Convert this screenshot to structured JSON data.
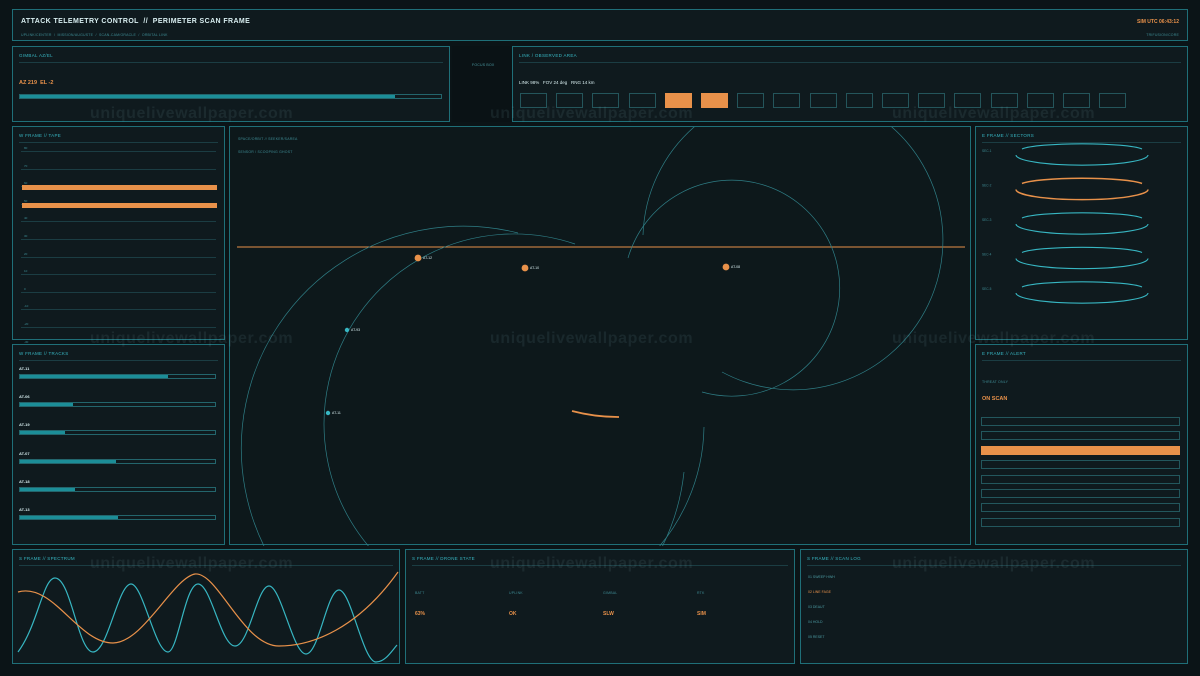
{
  "header": {
    "title": "ATTACK TELEMETRY CONTROL  //  PERIMETER SCAN FRAME",
    "breadcrumb": "UPLINK/CENTER  /  MISSION/AUGUSTE  /  SCAN-CAM/ORACLE  /  ORBITAL LINK",
    "clock": "SIM UTC 06:43:12",
    "mode": "TRIFUSION/CORE"
  },
  "gimbal": {
    "title": "GIMBAL AZ/EL",
    "readout": "AZ 219  EL -2",
    "progress": 0.89
  },
  "focus_badge": "FOCUS BOX",
  "link": {
    "title": "LINK / OBSERVED AREA",
    "stats": "LINK 98%   FOV 24 deg   RNG 14 km",
    "segments": [
      false,
      false,
      false,
      false,
      true,
      true,
      false,
      false,
      false,
      false,
      false,
      false,
      false,
      false,
      false,
      false,
      false
    ]
  },
  "tape": {
    "title": "W FRAME  //  TAPE",
    "labels": [
      "80",
      "70",
      "60",
      "50",
      "40",
      "30",
      "20",
      "10",
      "0",
      "-10",
      "-20",
      "-30"
    ]
  },
  "tracks": {
    "title": "W FRAME  //  TRACKS",
    "items": [
      {
        "id": "AT-11",
        "value": 0.76
      },
      {
        "id": "AT-06",
        "value": 0.27
      },
      {
        "id": "AT-19",
        "value": 0.23
      },
      {
        "id": "AT-07",
        "value": 0.49
      },
      {
        "id": "AT-18",
        "value": 0.28
      },
      {
        "id": "AT-13",
        "value": 0.5
      }
    ]
  },
  "center": {
    "title": "SPACE/ORBIT  //  SEEKER/SAREA",
    "subtitle": "SENSOR / SCOOPING GHOST",
    "targets": [
      {
        "id": "AT-12",
        "type": "orange"
      },
      {
        "id": "AT-10",
        "type": "orange"
      },
      {
        "id": "AT-08",
        "type": "orange"
      },
      {
        "id": "AT-93",
        "type": "teal"
      },
      {
        "id": "AT-11",
        "type": "teal"
      }
    ]
  },
  "sectors": {
    "title": "E FRAME  //  SECTORS",
    "labels": [
      "SEC-1",
      "SEC-2",
      "SEC-3",
      "SEC-4",
      "SEC-5"
    ],
    "active": 1
  },
  "alert": {
    "title": "E FRAME  //  ALERT",
    "caption": "THREAT ONLY",
    "status": "ON SCAN",
    "rows": [
      false,
      false,
      true,
      false,
      false,
      false,
      false,
      false
    ],
    "colors": {
      "accent": "#e8914a",
      "teal": "#37b6c2"
    }
  },
  "spectrum": {
    "title": "S FRAME  //  SPECTRUM"
  },
  "drone": {
    "title": "S FRAME  //  DRONE STATE",
    "cols": [
      {
        "label": "BATT",
        "value": "63%"
      },
      {
        "label": "UPLINK",
        "value": "OK"
      },
      {
        "label": "GIMBAL",
        "value": "SLW"
      },
      {
        "label": "RTK",
        "value": "SIM"
      }
    ]
  },
  "scanlog": {
    "title": "S FRAME  //  SCAN LOG",
    "items": [
      {
        "text": "01 SWEEP HWH",
        "hl": false
      },
      {
        "text": "02 LINE FAGE",
        "hl": true
      },
      {
        "text": "03 DEAUT",
        "hl": false
      },
      {
        "text": "04 HOLD",
        "hl": false
      },
      {
        "text": "05 RESET",
        "hl": false
      }
    ]
  },
  "watermark": "uniquelivewallpaper.com"
}
